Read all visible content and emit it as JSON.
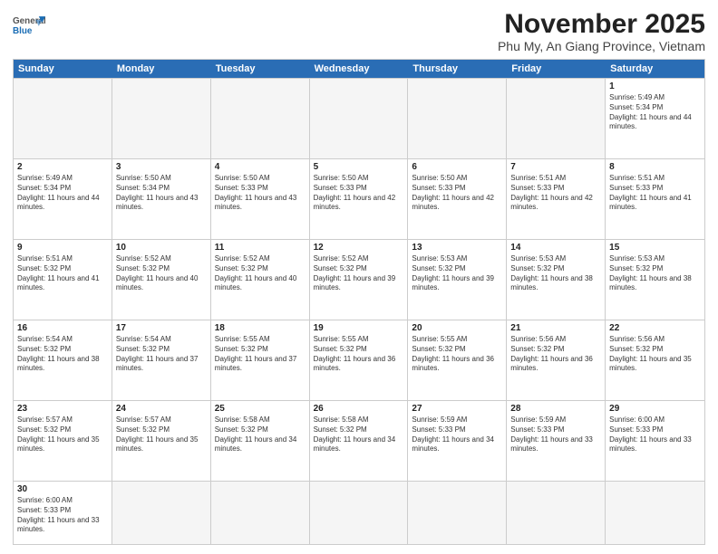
{
  "logo": {
    "general": "General",
    "blue": "Blue"
  },
  "header": {
    "month": "November 2025",
    "location": "Phu My, An Giang Province, Vietnam"
  },
  "days": [
    "Sunday",
    "Monday",
    "Tuesday",
    "Wednesday",
    "Thursday",
    "Friday",
    "Saturday"
  ],
  "weeks": [
    [
      {
        "day": "",
        "empty": true
      },
      {
        "day": "",
        "empty": true
      },
      {
        "day": "",
        "empty": true
      },
      {
        "day": "",
        "empty": true
      },
      {
        "day": "",
        "empty": true
      },
      {
        "day": "",
        "empty": true
      },
      {
        "day": "1",
        "sunrise": "Sunrise: 5:49 AM",
        "sunset": "Sunset: 5:34 PM",
        "daylight": "Daylight: 11 hours and 44 minutes."
      }
    ],
    [
      {
        "day": "2",
        "sunrise": "Sunrise: 5:49 AM",
        "sunset": "Sunset: 5:34 PM",
        "daylight": "Daylight: 11 hours and 44 minutes."
      },
      {
        "day": "3",
        "sunrise": "Sunrise: 5:50 AM",
        "sunset": "Sunset: 5:34 PM",
        "daylight": "Daylight: 11 hours and 43 minutes."
      },
      {
        "day": "4",
        "sunrise": "Sunrise: 5:50 AM",
        "sunset": "Sunset: 5:33 PM",
        "daylight": "Daylight: 11 hours and 43 minutes."
      },
      {
        "day": "5",
        "sunrise": "Sunrise: 5:50 AM",
        "sunset": "Sunset: 5:33 PM",
        "daylight": "Daylight: 11 hours and 42 minutes."
      },
      {
        "day": "6",
        "sunrise": "Sunrise: 5:50 AM",
        "sunset": "Sunset: 5:33 PM",
        "daylight": "Daylight: 11 hours and 42 minutes."
      },
      {
        "day": "7",
        "sunrise": "Sunrise: 5:51 AM",
        "sunset": "Sunset: 5:33 PM",
        "daylight": "Daylight: 11 hours and 42 minutes."
      },
      {
        "day": "8",
        "sunrise": "Sunrise: 5:51 AM",
        "sunset": "Sunset: 5:33 PM",
        "daylight": "Daylight: 11 hours and 41 minutes."
      }
    ],
    [
      {
        "day": "9",
        "sunrise": "Sunrise: 5:51 AM",
        "sunset": "Sunset: 5:32 PM",
        "daylight": "Daylight: 11 hours and 41 minutes."
      },
      {
        "day": "10",
        "sunrise": "Sunrise: 5:52 AM",
        "sunset": "Sunset: 5:32 PM",
        "daylight": "Daylight: 11 hours and 40 minutes."
      },
      {
        "day": "11",
        "sunrise": "Sunrise: 5:52 AM",
        "sunset": "Sunset: 5:32 PM",
        "daylight": "Daylight: 11 hours and 40 minutes."
      },
      {
        "day": "12",
        "sunrise": "Sunrise: 5:52 AM",
        "sunset": "Sunset: 5:32 PM",
        "daylight": "Daylight: 11 hours and 39 minutes."
      },
      {
        "day": "13",
        "sunrise": "Sunrise: 5:53 AM",
        "sunset": "Sunset: 5:32 PM",
        "daylight": "Daylight: 11 hours and 39 minutes."
      },
      {
        "day": "14",
        "sunrise": "Sunrise: 5:53 AM",
        "sunset": "Sunset: 5:32 PM",
        "daylight": "Daylight: 11 hours and 38 minutes."
      },
      {
        "day": "15",
        "sunrise": "Sunrise: 5:53 AM",
        "sunset": "Sunset: 5:32 PM",
        "daylight": "Daylight: 11 hours and 38 minutes."
      }
    ],
    [
      {
        "day": "16",
        "sunrise": "Sunrise: 5:54 AM",
        "sunset": "Sunset: 5:32 PM",
        "daylight": "Daylight: 11 hours and 38 minutes."
      },
      {
        "day": "17",
        "sunrise": "Sunrise: 5:54 AM",
        "sunset": "Sunset: 5:32 PM",
        "daylight": "Daylight: 11 hours and 37 minutes."
      },
      {
        "day": "18",
        "sunrise": "Sunrise: 5:55 AM",
        "sunset": "Sunset: 5:32 PM",
        "daylight": "Daylight: 11 hours and 37 minutes."
      },
      {
        "day": "19",
        "sunrise": "Sunrise: 5:55 AM",
        "sunset": "Sunset: 5:32 PM",
        "daylight": "Daylight: 11 hours and 36 minutes."
      },
      {
        "day": "20",
        "sunrise": "Sunrise: 5:55 AM",
        "sunset": "Sunset: 5:32 PM",
        "daylight": "Daylight: 11 hours and 36 minutes."
      },
      {
        "day": "21",
        "sunrise": "Sunrise: 5:56 AM",
        "sunset": "Sunset: 5:32 PM",
        "daylight": "Daylight: 11 hours and 36 minutes."
      },
      {
        "day": "22",
        "sunrise": "Sunrise: 5:56 AM",
        "sunset": "Sunset: 5:32 PM",
        "daylight": "Daylight: 11 hours and 35 minutes."
      }
    ],
    [
      {
        "day": "23",
        "sunrise": "Sunrise: 5:57 AM",
        "sunset": "Sunset: 5:32 PM",
        "daylight": "Daylight: 11 hours and 35 minutes."
      },
      {
        "day": "24",
        "sunrise": "Sunrise: 5:57 AM",
        "sunset": "Sunset: 5:32 PM",
        "daylight": "Daylight: 11 hours and 35 minutes."
      },
      {
        "day": "25",
        "sunrise": "Sunrise: 5:58 AM",
        "sunset": "Sunset: 5:32 PM",
        "daylight": "Daylight: 11 hours and 34 minutes."
      },
      {
        "day": "26",
        "sunrise": "Sunrise: 5:58 AM",
        "sunset": "Sunset: 5:32 PM",
        "daylight": "Daylight: 11 hours and 34 minutes."
      },
      {
        "day": "27",
        "sunrise": "Sunrise: 5:59 AM",
        "sunset": "Sunset: 5:33 PM",
        "daylight": "Daylight: 11 hours and 34 minutes."
      },
      {
        "day": "28",
        "sunrise": "Sunrise: 5:59 AM",
        "sunset": "Sunset: 5:33 PM",
        "daylight": "Daylight: 11 hours and 33 minutes."
      },
      {
        "day": "29",
        "sunrise": "Sunrise: 6:00 AM",
        "sunset": "Sunset: 5:33 PM",
        "daylight": "Daylight: 11 hours and 33 minutes."
      }
    ],
    [
      {
        "day": "30",
        "sunrise": "Sunrise: 6:00 AM",
        "sunset": "Sunset: 5:33 PM",
        "daylight": "Daylight: 11 hours and 33 minutes."
      },
      {
        "day": "",
        "empty": true
      },
      {
        "day": "",
        "empty": true
      },
      {
        "day": "",
        "empty": true
      },
      {
        "day": "",
        "empty": true
      },
      {
        "day": "",
        "empty": true
      },
      {
        "day": "",
        "empty": true
      }
    ]
  ]
}
